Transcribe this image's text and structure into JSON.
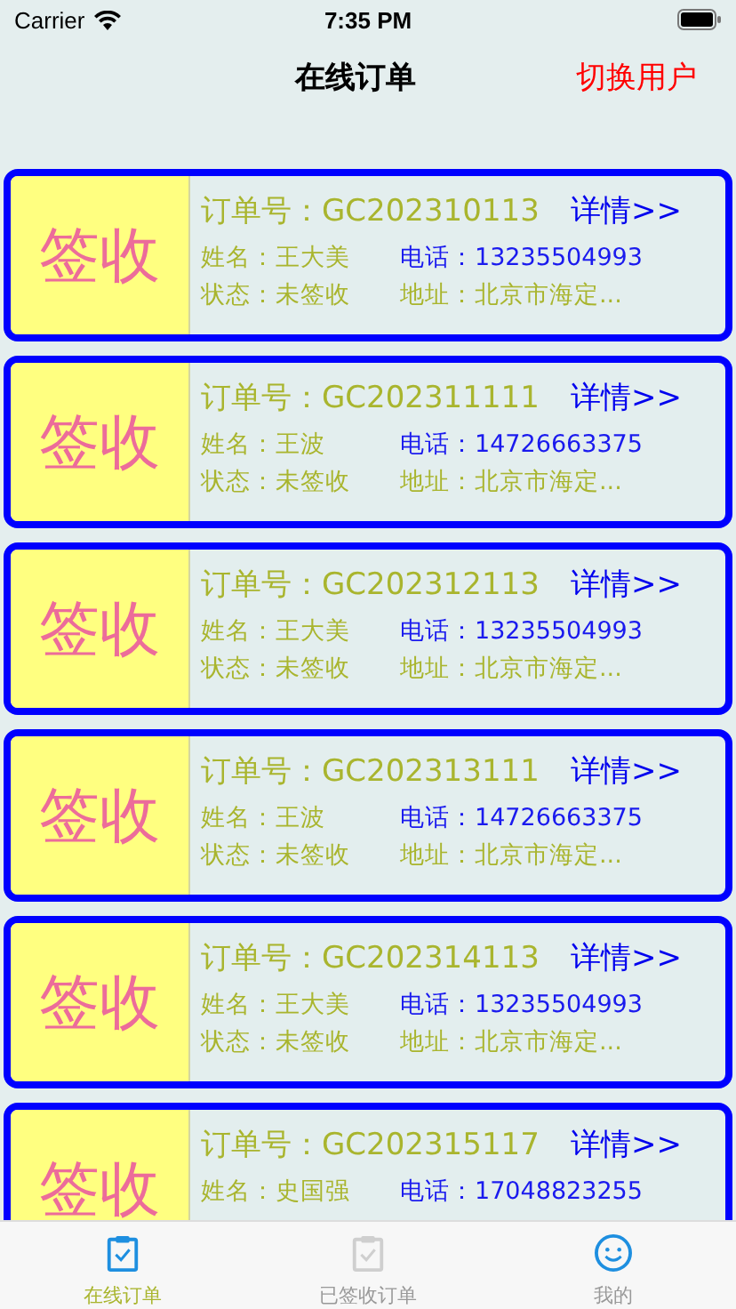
{
  "status_bar": {
    "carrier": "Carrier",
    "time": "7:35 PM"
  },
  "nav": {
    "title": "在线订单",
    "action": "切换用户"
  },
  "orders": [
    {
      "stamp": "签收",
      "order_label": "订单号：",
      "order_no": "GC202310113",
      "detail": "详情>>",
      "name": "姓名：王大美",
      "phone": "电话：13235504993",
      "status": "状态：未签收",
      "address": "地址：北京市海定..."
    },
    {
      "stamp": "签收",
      "order_label": "订单号：",
      "order_no": "GC202311111",
      "detail": "详情>>",
      "name": "姓名：王波",
      "phone": "电话：14726663375",
      "status": "状态：未签收",
      "address": "地址：北京市海定..."
    },
    {
      "stamp": "签收",
      "order_label": "订单号：",
      "order_no": "GC202312113",
      "detail": "详情>>",
      "name": "姓名：王大美",
      "phone": "电话：13235504993",
      "status": "状态：未签收",
      "address": "地址：北京市海定..."
    },
    {
      "stamp": "签收",
      "order_label": "订单号：",
      "order_no": "GC202313111",
      "detail": "详情>>",
      "name": "姓名：王波",
      "phone": "电话：14726663375",
      "status": "状态：未签收",
      "address": "地址：北京市海定..."
    },
    {
      "stamp": "签收",
      "order_label": "订单号：",
      "order_no": "GC202314113",
      "detail": "详情>>",
      "name": "姓名：王大美",
      "phone": "电话：13235504993",
      "status": "状态：未签收",
      "address": "地址：北京市海定..."
    },
    {
      "stamp": "签收",
      "order_label": "订单号：",
      "order_no": "GC202315117",
      "detail": "详情>>",
      "name": "姓名：史国强",
      "phone": "电话：17048823255"
    }
  ],
  "tab_bar": [
    {
      "label": "在线订单",
      "kind": "clipboard",
      "selected": true
    },
    {
      "label": "已签收订单",
      "kind": "clipboard",
      "selected": false
    },
    {
      "label": "我的",
      "kind": "smiley",
      "selected": false
    }
  ]
}
